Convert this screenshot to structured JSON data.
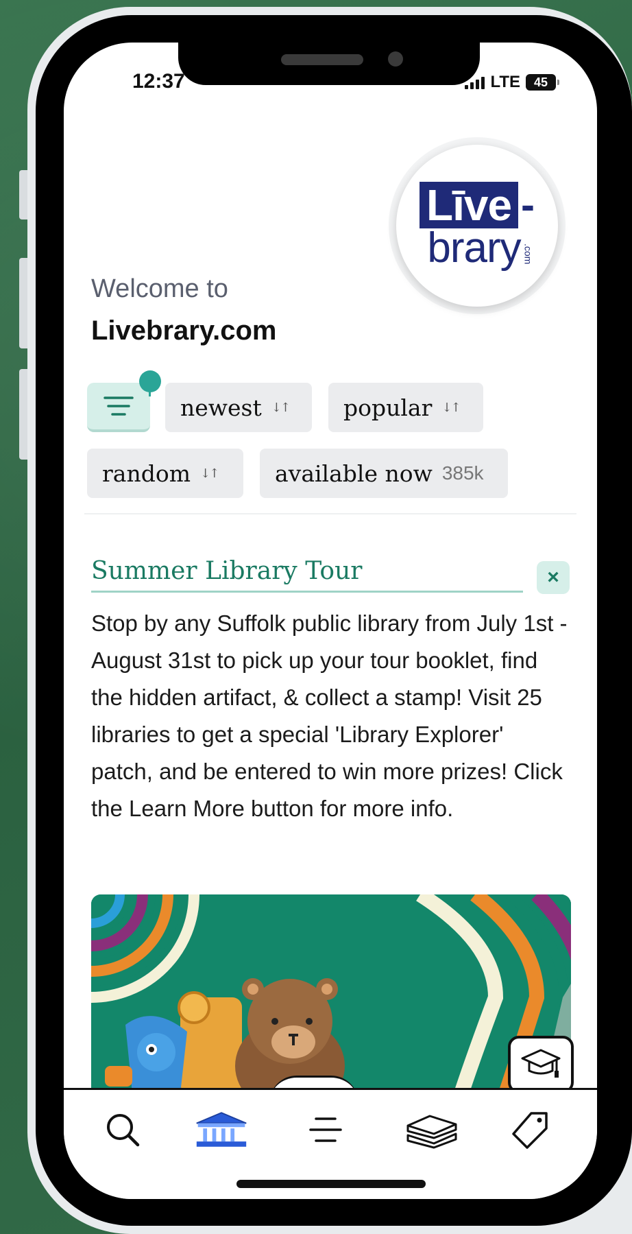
{
  "status_bar": {
    "time": "12:37",
    "network": "LTE",
    "battery": "45"
  },
  "logo": {
    "live": "Līve",
    "dash": "-",
    "brary": "brary",
    "com": ".com"
  },
  "header": {
    "welcome": "Welcome to",
    "site_name": "Livebrary.com"
  },
  "filters": {
    "filter_icon": "filter-lines-icon",
    "chips": [
      {
        "label": "newest",
        "icon": "sort-arrows-icon"
      },
      {
        "label": "popular",
        "icon": "sort-arrows-icon"
      },
      {
        "label": "random",
        "icon": "sort-arrows-icon"
      },
      {
        "label": "available now",
        "count": "385k"
      }
    ]
  },
  "announcement": {
    "title": "Summer Library Tour",
    "body": "Stop by any Suffolk public library from July 1st - August 31st to pick up your tour booklet, find the hidden artifact, & collect a stamp! Visit 25 libraries to get a special 'Library Explorer' patch, and be entered to win more prizes! Click the Learn More button for more info.",
    "close_icon": "close-icon"
  },
  "nav": {
    "items": [
      {
        "icon": "search-icon"
      },
      {
        "icon": "library-building-icon"
      },
      {
        "icon": "menu-icon"
      },
      {
        "icon": "books-stack-icon"
      },
      {
        "icon": "tag-icon"
      }
    ],
    "floating": {
      "icon": "graduation-cap-icon"
    }
  },
  "colors": {
    "accent": "#1a7a62",
    "accent_light": "#d6efe9",
    "chip_bg": "#ebecee",
    "brand_navy": "#1f2a78",
    "nav_active": "#2a5bd7"
  }
}
